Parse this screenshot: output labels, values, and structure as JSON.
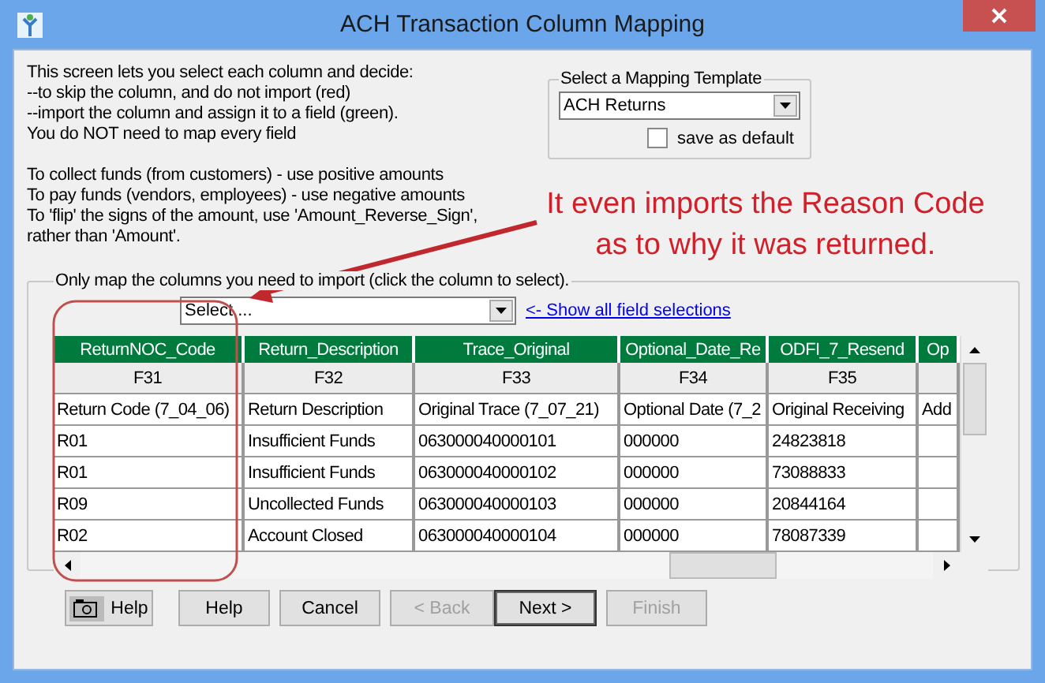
{
  "window": {
    "title": "ACH Transaction Column Mapping"
  },
  "instructions": [
    "This screen lets you select each column and decide:\n--to skip the column, and do not import (red)\n--import the column and assign it to a field (green).\nYou do NOT need to map every field",
    "To collect funds (from customers) - use positive amounts\nTo pay funds (vendors, employees) - use negative amounts\nTo 'flip' the signs of the amount, use 'Amount_Reverse_Sign',\nrather than 'Amount'."
  ],
  "template": {
    "legend": "Select a Mapping Template",
    "value": "ACH Returns",
    "save_default": {
      "label": "save as default",
      "checked": false
    }
  },
  "annotation": "It even imports the Reason Code as to why it was returned.",
  "mapping": {
    "legend": "Only map the columns you need to import (click the column to select).",
    "field_select": "Select ...",
    "link": "<-  Show all field selections",
    "columns": [
      {
        "header": "ReturnNOC_Code",
        "field": "F31",
        "description": "Return Code (7_04_06)"
      },
      {
        "header": "Return_Description",
        "field": "F32",
        "description": "Return Description"
      },
      {
        "header": "Trace_Original",
        "field": "F33",
        "description": "Original Trace (7_07_21)"
      },
      {
        "header": "Optional_Date_Re",
        "field": "F34",
        "description": "Optional Date (7_2"
      },
      {
        "header": "ODFI_7_Resend",
        "field": "F35",
        "description": "Original Receiving"
      },
      {
        "header": "Op",
        "description": "Add"
      }
    ],
    "rows": [
      [
        "R01",
        "Insufficient Funds",
        "063000040000101",
        "000000",
        "24823818"
      ],
      [
        "R01",
        "Insufficient Funds",
        "063000040000102",
        "000000",
        "73088833"
      ],
      [
        "R09",
        "Uncollected Funds",
        "063000040000103",
        "000000",
        "20844164"
      ],
      [
        "R02",
        "Account Closed",
        "063000040000104",
        "000000",
        "78087339"
      ]
    ]
  },
  "buttons": [
    {
      "kind": "icon",
      "label": "Help",
      "disabled": false,
      "default": false
    },
    {
      "kind": "plain",
      "label": "Help",
      "disabled": false,
      "default": false
    },
    {
      "kind": "plain",
      "label": "Cancel",
      "disabled": false,
      "default": false
    },
    {
      "kind": "plain",
      "label": "< Back",
      "disabled": true,
      "default": false
    },
    {
      "kind": "plain",
      "label": "Next >",
      "disabled": false,
      "default": true
    },
    {
      "kind": "plain",
      "label": "Finish",
      "disabled": true,
      "default": false
    }
  ]
}
